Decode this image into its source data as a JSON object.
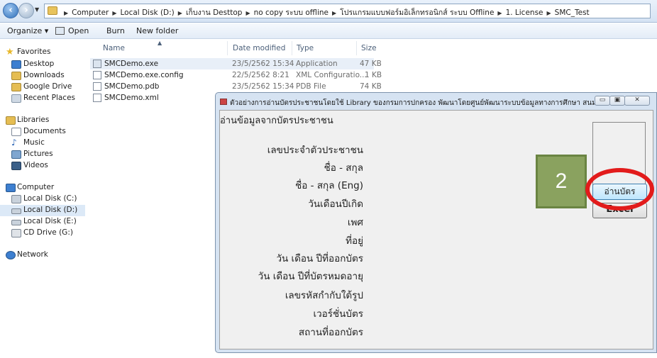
{
  "address_bar": {
    "crumbs": [
      "Computer",
      "Local Disk (D:)",
      "เก็บงาน Desttop",
      "no copy ระบบ offline",
      "โปรแกรมแบบฟอร์มอิเล็กทรอนิกส์ ระบบ Offline",
      "1. License",
      "SMC_Test"
    ]
  },
  "toolbar": {
    "organize": "Organize ▾",
    "open": "Open",
    "burn": "Burn",
    "new_folder": "New folder"
  },
  "nav": {
    "favorites": "Favorites",
    "desktop": "Desktop",
    "downloads": "Downloads",
    "google_drive": "Google Drive",
    "recent_places": "Recent Places",
    "libraries": "Libraries",
    "documents": "Documents",
    "music": "Music",
    "pictures": "Pictures",
    "videos": "Videos",
    "computer": "Computer",
    "local_c": "Local Disk (C:)",
    "local_d": "Local Disk (D:)",
    "local_e": "Local Disk (E:)",
    "cd_drive": "CD Drive (G:)",
    "network": "Network"
  },
  "columns": {
    "name": "Name",
    "date": "Date modified",
    "type": "Type",
    "size": "Size"
  },
  "files": [
    {
      "name": "SMCDemo.exe",
      "date": "23/5/2562 15:34",
      "type": "Application",
      "size": "47 KB"
    },
    {
      "name": "SMCDemo.exe.config",
      "date": "22/5/2562 8:21",
      "type": "XML Configuratio...",
      "size": "1 KB"
    },
    {
      "name": "SMCDemo.pdb",
      "date": "23/5/2562 15:34",
      "type": "PDB File",
      "size": "74 KB"
    },
    {
      "name": "SMCDemo.xml",
      "date": "",
      "type": "",
      "size": ""
    }
  ],
  "app": {
    "title": "ตัวอย่างการอ่านบัตรประชาชนโดยใช้ Library ของกรมการปกครอง พัฒนาโดยศูนย์พัฒนาระบบข้อมูลทางการศึกษา สนม. ส...",
    "min": "▭",
    "max": "▣",
    "close": "✕",
    "header": "อ่านข้อมูลจากบัตรประชาชน",
    "labels": [
      "เลขประจำตัวประชาชน",
      "ชื่อ - สกุล",
      "ชื่อ - สกุล (Eng)",
      "วันเดือนปีเกิด",
      "เพศ",
      "ที่อยู่",
      "วัน เดือน ปีที่ออกบัตร",
      "วัน เดือน ปีที่บัตรหมดอายุ",
      "เลขรหัสกำกับใต้รูป",
      "เวอร์ชั่นบัตร",
      "สถานที่ออกบัตร"
    ],
    "read_button": "อ่านบัตร",
    "excel_button": "Excel"
  },
  "annotation": {
    "step": "2",
    "highlight_color": "#e21b1b",
    "badge_color": "#8aa25f"
  }
}
